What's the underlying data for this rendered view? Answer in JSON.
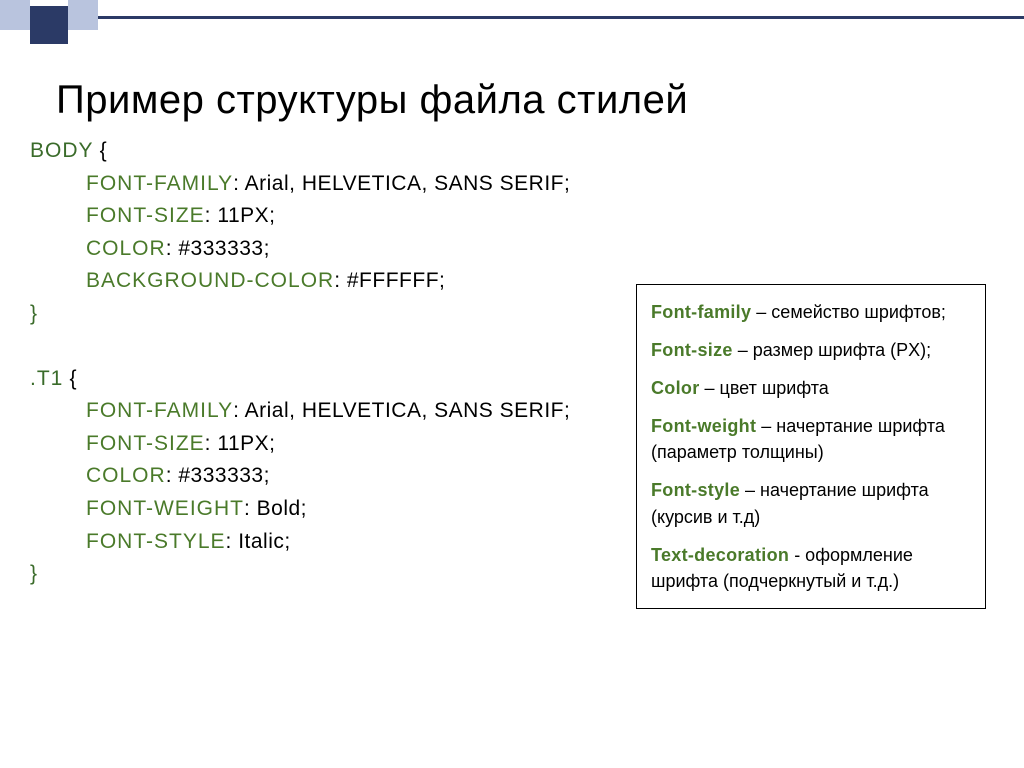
{
  "title": "Пример структуры файла стилей",
  "code": {
    "block1": {
      "selector": "BODY",
      "brace_open": " {",
      "lines": [
        {
          "prop": "FONT-FAMILY",
          "val": ": Arial, HELVETICA, SANS SERIF;"
        },
        {
          "prop": "FONT-SIZE",
          "val": ": 11PX;"
        },
        {
          "prop": "COLOR",
          "val": ":   #333333;"
        },
        {
          "prop": "BACKGROUND-COLOR",
          "val": ":    #FFFFFF;"
        }
      ],
      "brace_close": "}"
    },
    "block2": {
      "selector": ".T1",
      "brace_open": " {",
      "lines": [
        {
          "prop": "FONT-FAMILY",
          "val": ": Arial, HELVETICA, SANS SERIF;"
        },
        {
          "prop": "FONT-SIZE",
          "val": ": 11PX;"
        },
        {
          "prop": "COLOR",
          "val": ":    #333333;"
        },
        {
          "prop": "FONT-WEIGHT",
          "val": ":   Bold;"
        },
        {
          "prop": "FONT-STYLE",
          "val": ":   Italic;"
        }
      ],
      "brace_close": "}"
    }
  },
  "legend": [
    {
      "term": "Font-family",
      "desc": " – семейство шрифтов;"
    },
    {
      "term": "Font-size",
      "desc": " – размер шрифта (PX);"
    },
    {
      "term": "Color",
      "desc": " – цвет шрифта"
    },
    {
      "term": "Font-weight",
      "desc": " – начертание шрифта (параметр толщины)"
    },
    {
      "term": "Font-style",
      "desc": " – начертание шрифта (курсив и т.д)"
    },
    {
      "term": "Text-decoration",
      "desc": "  - оформление шрифта (подчеркнутый и т.д.)"
    }
  ]
}
